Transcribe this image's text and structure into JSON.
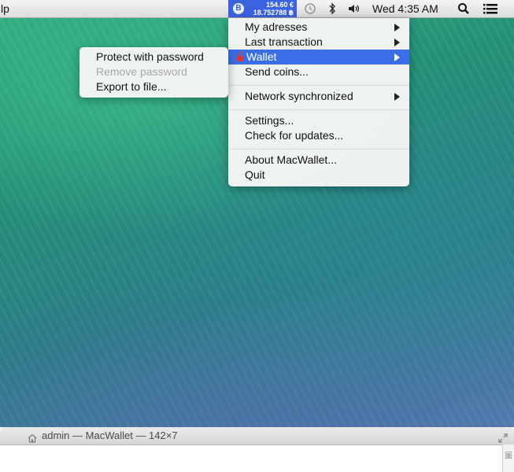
{
  "menubar": {
    "left_partial_label": "lp",
    "bitcoin": {
      "icon": "bitcoin-icon",
      "fiat_balance": "154.60 €",
      "btc_balance": "18.752788 ฿"
    },
    "clock": "Wed 4:35 AM",
    "icons": [
      "time-machine-icon",
      "bluetooth-icon",
      "volume-icon",
      "spotlight-search-icon",
      "notification-center-icon"
    ]
  },
  "main_menu": {
    "items": [
      {
        "label": "My adresses",
        "has_submenu": true
      },
      {
        "label": "Last transaction",
        "has_submenu": true
      },
      {
        "label": "Wallet",
        "has_submenu": true,
        "highlighted": true,
        "icon": "lock-icon"
      },
      {
        "label": "Send coins...",
        "has_submenu": false
      },
      {
        "label": "Network synchronized",
        "has_submenu": true
      },
      {
        "label": "Settings...",
        "has_submenu": false
      },
      {
        "label": "Check for updates...",
        "has_submenu": false
      },
      {
        "label": "About MacWallet...",
        "has_submenu": false
      },
      {
        "label": "Quit",
        "has_submenu": false
      }
    ]
  },
  "wallet_submenu": {
    "items": [
      {
        "label": "Protect with password",
        "enabled": true
      },
      {
        "label": "Remove password",
        "enabled": false
      },
      {
        "label": "Export to file...",
        "enabled": true
      }
    ]
  },
  "terminal": {
    "title": "admin — MacWallet — 142×7",
    "icons": [
      "home-icon",
      "expand-icon"
    ]
  },
  "colors": {
    "highlight": "#3a6ee6",
    "status_item_bg": "#3b63e0",
    "disabled_text": "#a8a8a8"
  }
}
